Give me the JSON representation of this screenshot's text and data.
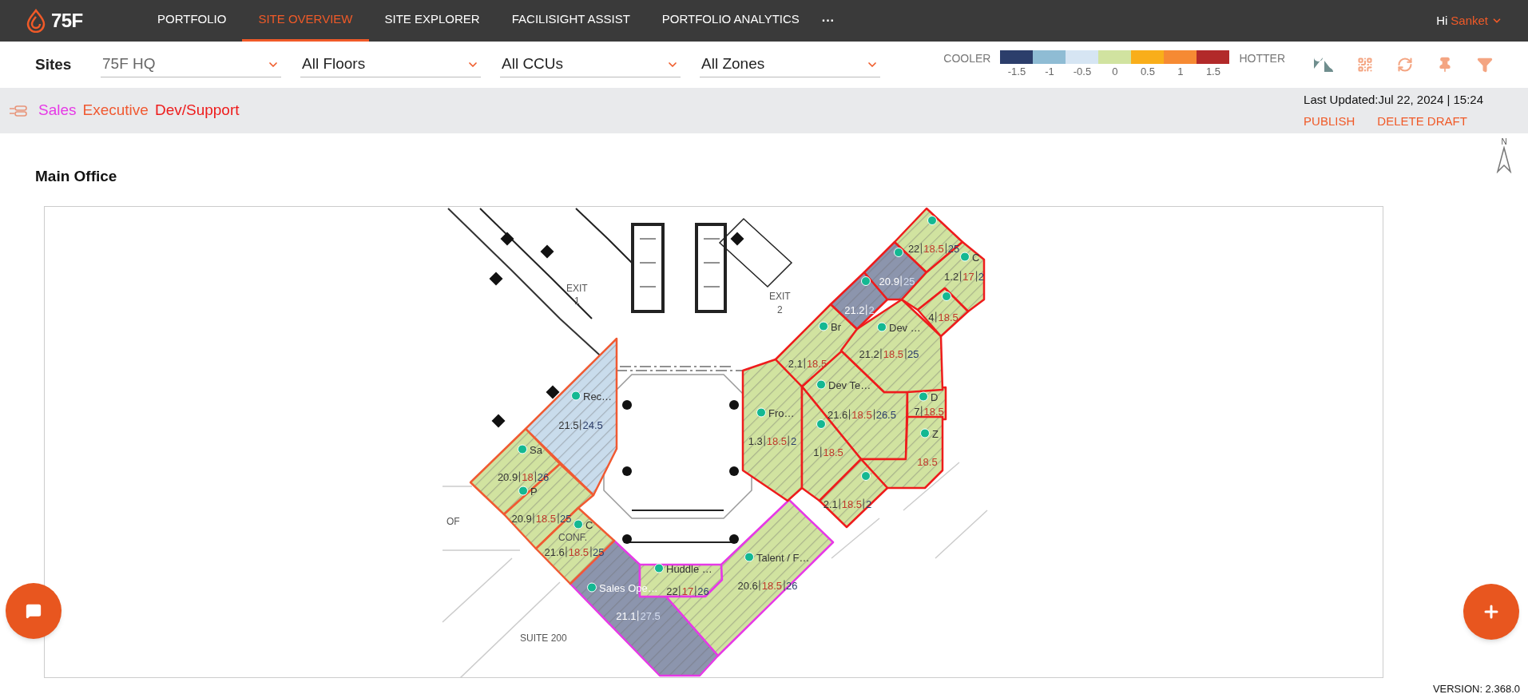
{
  "header": {
    "logo_text": "75F",
    "nav": [
      {
        "label": "PORTFOLIO",
        "selected": false
      },
      {
        "label": "SITE OVERVIEW",
        "selected": true
      },
      {
        "label": "SITE EXPLORER",
        "selected": false
      },
      {
        "label": "FACILISIGHT ASSIST",
        "selected": false
      },
      {
        "label": "PORTFOLIO ANALYTICS",
        "selected": false
      }
    ],
    "more": "···",
    "greeting": "Hi",
    "user": "Sanket"
  },
  "filters": {
    "label": "Sites",
    "dropdowns": [
      {
        "value": "75F HQ",
        "kind": "muted"
      },
      {
        "value": "All Floors",
        "kind": "normal"
      },
      {
        "value": "All CCUs",
        "kind": "normal"
      },
      {
        "value": "All Zones",
        "kind": "normal"
      }
    ]
  },
  "legend": {
    "cooler": "COOLER",
    "hotter": "HOTTER",
    "steps": [
      {
        "label": "-1.5",
        "color": "#2c3e6b"
      },
      {
        "label": "-1",
        "color": "#8fbcd4"
      },
      {
        "label": "-0.5",
        "color": "#d6e5f3"
      },
      {
        "label": "0",
        "color": "#d1e3a0"
      },
      {
        "label": "0.5",
        "color": "#f9ae1a"
      },
      {
        "label": "1",
        "color": "#f68a33"
      },
      {
        "label": "1.5",
        "color": "#b22a2a"
      }
    ]
  },
  "last_updated": "Last Updated:Jul 22, 2024 | 15:24",
  "actions": [
    "PUBLISH",
    "DELETE DRAFT"
  ],
  "floor_title": "Main Office",
  "north_label": "N",
  "floor_plan_labels": [
    "EXIT",
    "1",
    "EXIT",
    "2",
    "OF",
    "CONF.",
    "SUITE 200"
  ],
  "groups": [
    {
      "name": "Sales",
      "color": "#e639e6",
      "zones": [
        {
          "name": "Sales Ope…",
          "color": "#8c95ad",
          "readings": [
            {
              "kind": "current",
              "value": "21.1"
            },
            {
              "kind": "cool",
              "value": "27.5"
            }
          ]
        },
        {
          "name": "Huddle …",
          "color": "#d1e3a0",
          "readings": [
            {
              "kind": "current",
              "value": "22"
            },
            {
              "kind": "heat",
              "value": "17"
            },
            {
              "kind": "cool",
              "value": "26"
            }
          ]
        },
        {
          "name": "Talent / F…",
          "color": "#d1e3a0",
          "readings": [
            {
              "kind": "current",
              "value": "20.6"
            },
            {
              "kind": "heat",
              "value": "18.5"
            },
            {
              "kind": "cool",
              "value": "26"
            }
          ]
        }
      ]
    },
    {
      "name": "Executive",
      "color": "#f05a32",
      "zones": [
        {
          "name": "Rec…",
          "color": "#c9dcec",
          "readings": [
            {
              "kind": "current",
              "value": "21.5"
            },
            {
              "kind": "cool",
              "value": "24.5"
            }
          ]
        },
        {
          "name": "Sa",
          "color": "#d1e3a0",
          "readings": [
            {
              "kind": "current",
              "value": "20.9"
            },
            {
              "kind": "heat",
              "value": "18"
            },
            {
              "kind": "cool",
              "value": "26"
            }
          ]
        },
        {
          "name": "P",
          "color": "#d1e3a0",
          "readings": [
            {
              "kind": "current",
              "value": "20.9"
            },
            {
              "kind": "heat",
              "value": "18.5"
            },
            {
              "kind": "cool",
              "value": "25"
            }
          ]
        },
        {
          "name": "C",
          "color": "#d1e3a0",
          "readings": [
            {
              "kind": "current",
              "value": "21.6"
            },
            {
              "kind": "heat",
              "value": "18.5"
            },
            {
              "kind": "cool",
              "value": "25"
            }
          ]
        }
      ]
    },
    {
      "name": "Dev/Support",
      "color": "#ee1c1c",
      "zones": [
        {
          "name": "Fro…",
          "color": "#d1e3a0",
          "readings": [
            {
              "kind": "current",
              "value": "1.3"
            },
            {
              "kind": "heat",
              "value": "18.5"
            },
            {
              "kind": "cool",
              "value": "2"
            }
          ]
        },
        {
          "name": "Dev Te…",
          "color": "#d1e3a0",
          "readings": [
            {
              "kind": "current",
              "value": "21.6"
            },
            {
              "kind": "heat",
              "value": "18.5"
            },
            {
              "kind": "cool",
              "value": "26.5"
            }
          ]
        },
        {
          "color": "#d1e3a0",
          "readings": [
            {
              "kind": "current",
              "value": "1"
            },
            {
              "kind": "heat",
              "value": "18.5"
            }
          ]
        },
        {
          "name": "D",
          "color": "#d1e3a0",
          "readings": [
            {
              "kind": "current",
              "value": "7"
            },
            {
              "kind": "heat",
              "value": "18.5"
            }
          ]
        },
        {
          "name": "Z",
          "color": "#d1e3a0",
          "readings": [
            {
              "kind": "heat",
              "value": "18.5"
            }
          ]
        },
        {
          "color": "#d1e3a0",
          "readings": [
            {
              "kind": "current",
              "value": "2.1"
            },
            {
              "kind": "heat",
              "value": "18.5"
            },
            {
              "kind": "cool",
              "value": "2"
            }
          ]
        },
        {
          "name": "Br",
          "color": "#d1e3a0",
          "readings": [
            {
              "kind": "current",
              "value": "2.1"
            },
            {
              "kind": "heat",
              "value": "18.5"
            }
          ]
        },
        {
          "name": "Dev …",
          "color": "#d1e3a0",
          "readings": [
            {
              "kind": "current",
              "value": "21.2"
            },
            {
              "kind": "heat",
              "value": "18.5"
            },
            {
              "kind": "cool",
              "value": "25"
            }
          ]
        },
        {
          "color": "#8c95ad",
          "readings": [
            {
              "kind": "current",
              "value": "21.2"
            },
            {
              "kind": "cool",
              "value": "2"
            }
          ]
        },
        {
          "color": "#8c95ad",
          "readings": [
            {
              "kind": "current",
              "value": "20.9"
            },
            {
              "kind": "cool",
              "value": "25"
            }
          ]
        },
        {
          "color": "#d1e3a0",
          "readings": [
            {
              "kind": "current",
              "value": "22"
            },
            {
              "kind": "heat",
              "value": "18.5"
            },
            {
              "kind": "cool",
              "value": "25"
            }
          ]
        },
        {
          "name": "C",
          "color": "#d1e3a0",
          "readings": [
            {
              "kind": "current",
              "value": "1.2"
            },
            {
              "kind": "heat",
              "value": "17"
            },
            {
              "kind": "cool",
              "value": "2"
            }
          ]
        },
        {
          "color": "#d1e3a0",
          "readings": [
            {
              "kind": "current",
              "value": "4"
            },
            {
              "kind": "heat",
              "value": "18.5"
            }
          ]
        }
      ]
    }
  ],
  "version": "VERSION: 2.368.0"
}
